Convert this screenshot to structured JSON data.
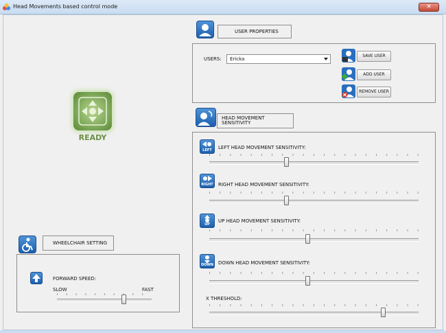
{
  "window": {
    "title": "Head Movements based control mode",
    "close_glyph": "✕"
  },
  "status": {
    "label": "READY"
  },
  "user_properties": {
    "header": "USER PROPERTIES",
    "users_label": "USERS:",
    "selected_user": "Ericka",
    "buttons": {
      "save": "SAVE USER",
      "add": "ADD USER",
      "remove": "REMOVE USER"
    }
  },
  "head_sensitivity": {
    "header": "HEAD MOVEMENT SENSITIVITY",
    "sliders": [
      {
        "label": "LEFT HEAD MOVEMENT SENSITIVITY:",
        "tag": "LEFT",
        "value": 0.37
      },
      {
        "label": "RIGHT HEAD MOVEMENT SENSITIVITY:",
        "tag": "RIGHT",
        "value": 0.37
      },
      {
        "label": "UP HEAD MOVEMENT SENSITIVITY:",
        "tag": "UP",
        "value": 0.47
      },
      {
        "label": "DOWN HEAD MOVEMENT SENSITIVITY:",
        "tag": "DOWN",
        "value": 0.47
      },
      {
        "label": "X THRESHOLD:",
        "value": 0.83
      }
    ]
  },
  "wheelchair": {
    "header": "WHEELCHAIR SETTING",
    "forward_speed_label": "FORWARD SPEED:",
    "slow_label": "SLOW",
    "fast_label": "FAST",
    "speed_value": 0.71
  },
  "icons": [
    "app-icon",
    "user-icon",
    "save-user-icon",
    "add-user-icon",
    "remove-user-icon",
    "head-icon",
    "left-arrow-icon",
    "right-arrow-icon",
    "up-arrow-icon",
    "down-arrow-icon",
    "wheelchair-icon",
    "forward-arrow-icon",
    "ready-directional-icon"
  ],
  "colors": {
    "ready_green": "#6a8f43",
    "tile_blue": "#1c5fae",
    "close_red": "#c24a38"
  }
}
